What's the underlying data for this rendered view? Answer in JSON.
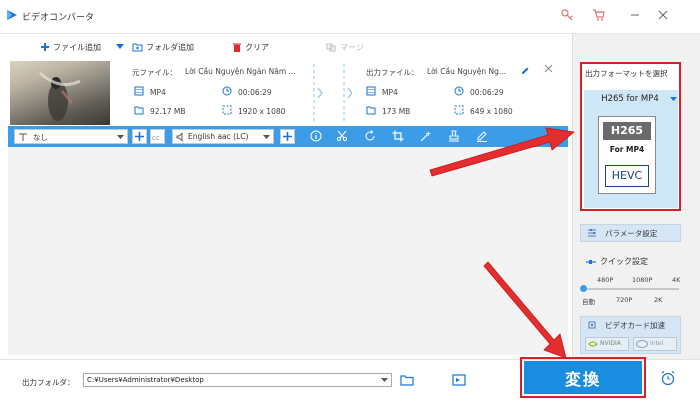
{
  "app": {
    "title": "ビデオコンバータ"
  },
  "toolbar": {
    "add_file": "ファイル追加",
    "add_folder": "フォルダ追加",
    "clear": "クリア",
    "merge": "マージ"
  },
  "file": {
    "source_label": "元ファイル：",
    "source_name": "Lời Cầu Nguyện Ngàn Năm ...",
    "output_label": "出力ファイル：",
    "output_name": "Lời Cầu Nguyện Ng...",
    "source": {
      "format": "MP4",
      "duration": "00:06:29",
      "size": "92.17 MB",
      "resolution": "1920 x 1080"
    },
    "output": {
      "format": "MP4",
      "duration": "00:06:29",
      "size": "173 MB",
      "resolution": "649 x 1080"
    }
  },
  "editbar": {
    "subtitle_value": "なし",
    "audio_value": "English aac (LC)"
  },
  "right": {
    "format_header": "出力フォーマットを選択",
    "format_selected": "H265 for MP4",
    "card_top": "H265",
    "card_mid": "For MP4",
    "card_bottom": "HEVC",
    "param_label": "パラメータ設定",
    "quick_label": "クイック設定",
    "quick_top": [
      "480P",
      "1080P",
      "4K"
    ],
    "quick_bottom": [
      "自動",
      "720P",
      "2K"
    ],
    "gpu_label": "ビデオカード加速",
    "gpu_nvidia": "NVIDIA",
    "gpu_intel": "Intel"
  },
  "bottom": {
    "output_folder_label": "出力フォルダ：",
    "output_path": "C:¥Users¥Administrator¥Desktop",
    "convert_label": "変換"
  },
  "colors": {
    "accent": "#3d9ce8",
    "highlight": "#d7202a",
    "convert": "#1a8de0"
  }
}
